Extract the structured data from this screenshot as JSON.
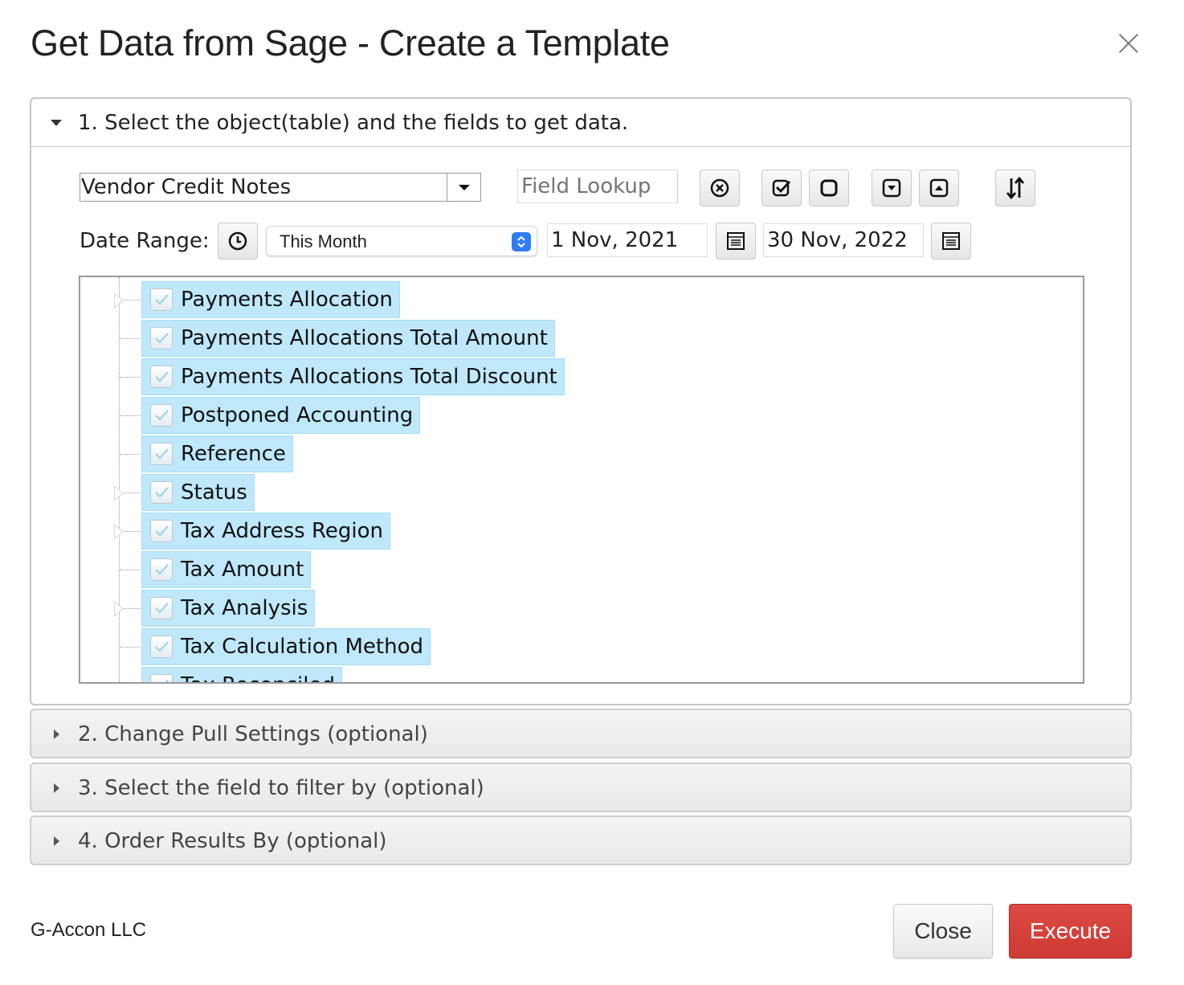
{
  "dialog": {
    "title": "Get Data from Sage - Create a Template",
    "close_icon": "close-icon"
  },
  "section1": {
    "header": "1. Select the object(table) and the fields to get data.",
    "object_select_value": "Vendor Credit Notes",
    "field_lookup_placeholder": "Field Lookup",
    "toolbar_icons": [
      "clear-circle-x-icon",
      "check-all-icon",
      "uncheck-all-icon",
      "expand-all-icon",
      "collapse-all-icon",
      "sort-icon"
    ],
    "date_range_label": "Date Range:",
    "date_range_select_value": "This Month",
    "date_from": "1 Nov, 2021",
    "date_to": "30 Nov, 2022",
    "tree_items": [
      {
        "label": "Payments Allocation",
        "checked": true,
        "expandable": true
      },
      {
        "label": "Payments Allocations Total Amount",
        "checked": true,
        "expandable": false
      },
      {
        "label": "Payments Allocations Total Discount",
        "checked": true,
        "expandable": false
      },
      {
        "label": "Postponed Accounting",
        "checked": true,
        "expandable": false
      },
      {
        "label": "Reference",
        "checked": true,
        "expandable": false
      },
      {
        "label": "Status",
        "checked": true,
        "expandable": true
      },
      {
        "label": "Tax Address Region",
        "checked": true,
        "expandable": true
      },
      {
        "label": "Tax Amount",
        "checked": true,
        "expandable": false
      },
      {
        "label": "Tax Analysis",
        "checked": true,
        "expandable": true
      },
      {
        "label": "Tax Calculation Method",
        "checked": true,
        "expandable": false
      },
      {
        "label": "Tax Reconciled",
        "checked": true,
        "expandable": false
      }
    ]
  },
  "section2": {
    "header": "2. Change Pull Settings (optional)"
  },
  "section3": {
    "header": "3. Select the field to filter by (optional)"
  },
  "section4": {
    "header": "4. Order Results By (optional)"
  },
  "footer": {
    "brand": "G-Accon LLC",
    "close_label": "Close",
    "execute_label": "Execute"
  },
  "colors": {
    "accent_red": "#d2403a",
    "tree_highlight": "#bfe8fb",
    "select_stepper_blue": "#2f7cf6"
  }
}
